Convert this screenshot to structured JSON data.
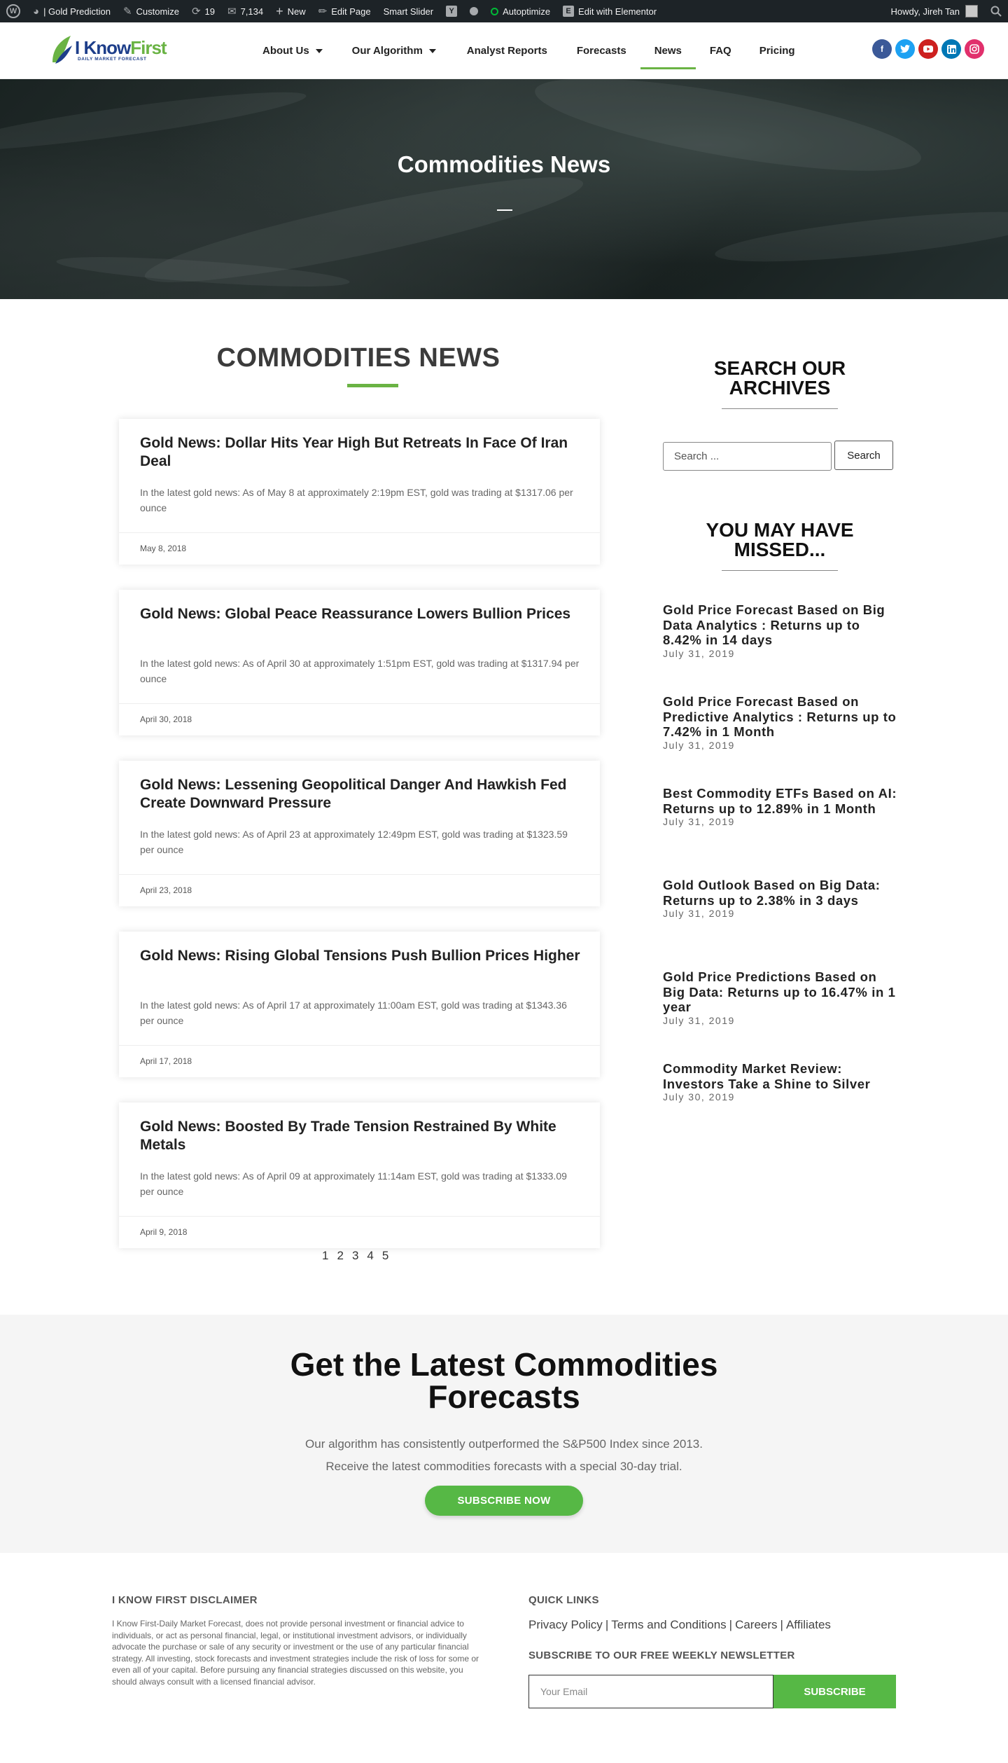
{
  "admin_bar": {
    "site_name": "| Gold Prediction",
    "customize": "Customize",
    "updates_count": "19",
    "comments_count": "7,134",
    "new": "New",
    "edit_page": "Edit Page",
    "smart_slider": "Smart Slider",
    "autoptimize": "Autoptimize",
    "edit_elementor": "Edit with Elementor",
    "howdy": "Howdy, Jireh Tan"
  },
  "header": {
    "logo_text_1": "I Know",
    "logo_text_2": "First",
    "logo_tagline": "DAILY MARKET FORECAST",
    "nav": [
      {
        "label": "About Us"
      },
      {
        "label": "Our Algorithm"
      },
      {
        "label": "Analyst Reports"
      },
      {
        "label": "Forecasts"
      },
      {
        "label": "News"
      },
      {
        "label": "FAQ"
      },
      {
        "label": "Pricing"
      }
    ],
    "social_colors": {
      "facebook": "#3b5998",
      "twitter": "#1da1f2",
      "youtube": "#cd201f",
      "linkedin": "#0077b5",
      "instagram": "#e1306c"
    }
  },
  "hero": {
    "title": "Commodities News"
  },
  "main": {
    "title": "COMMODITIES NEWS",
    "accent_color": "#6ab344",
    "posts": [
      {
        "title": "Gold News: Dollar Hits Year High But Retreats In Face Of Iran Deal",
        "excerpt": "In the latest gold news: As of May 8 at approximately 2:19pm EST, gold was trading at $1317.06 per ounce",
        "date": "May 8, 2018"
      },
      {
        "title": "Gold News: Global Peace Reassurance Lowers Bullion Prices",
        "excerpt": "In the latest gold news: As of April 30 at approximately 1:51pm EST, gold was trading at $1317.94 per ounce",
        "date": "April 30, 2018"
      },
      {
        "title": "Gold News: Lessening Geopolitical Danger And Hawkish Fed Create Downward Pressure",
        "excerpt": "In the latest gold news: As of April 23 at approximately 12:49pm EST, gold was trading at $1323.59 per ounce",
        "date": "April 23, 2018"
      },
      {
        "title": "Gold News: Rising Global Tensions Push Bullion Prices Higher",
        "excerpt": "In the latest gold news: As of April 17 at approximately 11:00am EST, gold was trading at $1343.36 per ounce",
        "date": "April 17, 2018"
      },
      {
        "title": "Gold News: Boosted By Trade Tension Restrained By White Metals",
        "excerpt": "In the latest gold news: As of April 09 at approximately 11:14am EST, gold was trading at $1333.09 per ounce",
        "date": "April 9, 2018"
      }
    ],
    "pagination": [
      "1",
      "2",
      "3",
      "4",
      "5"
    ]
  },
  "sidebar": {
    "search_title_1": "SEARCH OUR",
    "search_title_2": "ARCHIVES",
    "search_placeholder": "Search ...",
    "search_button": "Search",
    "missed_title_1": "YOU MAY HAVE",
    "missed_title_2": "MISSED...",
    "missed": [
      {
        "title": "Gold Price Forecast Based on Big Data Analytics : Returns up to 8.42% in 14 days",
        "date": "July 31, 2019"
      },
      {
        "title": "Gold Price Forecast Based on Predictive Analytics : Returns up to 7.42% in 1 Month",
        "date": "July 31, 2019"
      },
      {
        "title": "Best Commodity ETFs Based on AI: Returns up to 12.89% in 1 Month",
        "date": "July 31, 2019"
      },
      {
        "title": "Gold Outlook Based on Big Data: Returns up to 2.38% in 3 days",
        "date": "July 31, 2019"
      },
      {
        "title": "Gold Price Predictions Based on Big Data: Returns up to 16.47% in 1 year",
        "date": "July 31, 2019"
      },
      {
        "title": "Commodity Market Review: Investors Take a Shine to Silver",
        "date": "July 30, 2019"
      }
    ]
  },
  "cta": {
    "title_1": "Get the Latest Commodities",
    "title_2": "Forecasts",
    "text_1": "Our algorithm has consistently outperformed the S&P500 Index since 2013.",
    "text_2": "Receive the latest commodities forecasts with a special 30-day trial.",
    "button": "SUBSCRIBE NOW",
    "button_color": "#56b845"
  },
  "footer": {
    "disclaimer_title": "I KNOW FIRST DISCLAIMER",
    "disclaimer_text": "I Know First-Daily Market Forecast, does not provide personal investment or financial advice to individuals, or act as personal financial, legal, or institutional investment advisors, or individually advocate the purchase or sale of any security or investment or the use of any particular financial strategy. All investing, stock forecasts and investment strategies include the risk of loss for some or even all of your capital. Before pursuing any financial strategies discussed on this website, you should always consult with a licensed financial advisor.",
    "quick_links_title": "QUICK LINKS",
    "links": [
      "Privacy Policy",
      "Terms and Conditions",
      "Careers",
      "Affiliates"
    ],
    "newsletter_title": "SUBSCRIBE TO OUR FREE WEEKLY NEWSLETTER",
    "email_placeholder": "Your Email",
    "subscribe_button": "SUBSCRIBE"
  }
}
